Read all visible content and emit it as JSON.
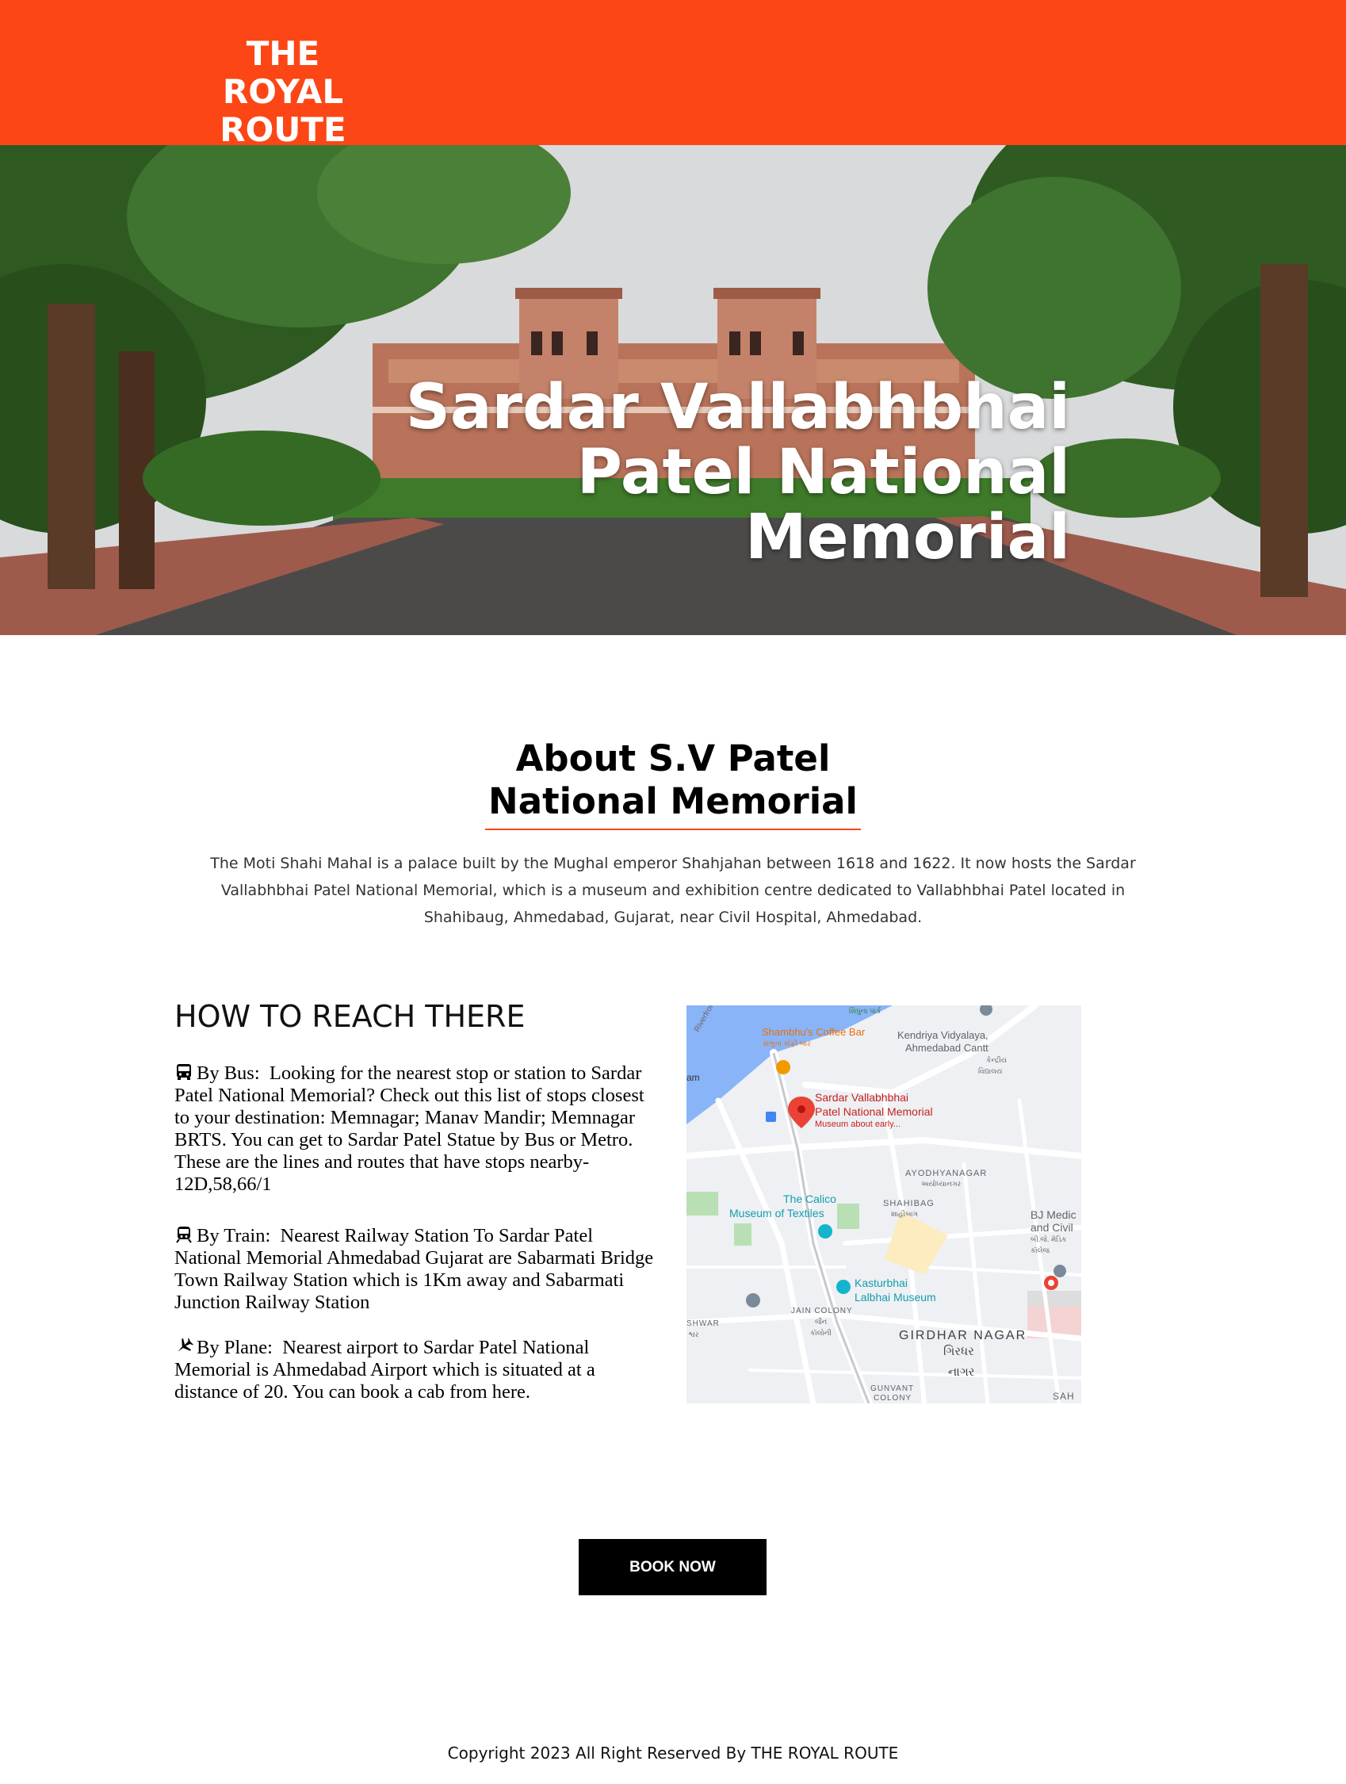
{
  "header": {
    "logo_line1": "THE ROYAL",
    "logo_line2": "ROUTE",
    "background": "#fc4616"
  },
  "hero": {
    "title_line1": "Sardar Vallabhbhai",
    "title_line2": "Patel National Memorial"
  },
  "about": {
    "title_line1": "About S.V Patel",
    "title_line2": "National Memorial",
    "text": "The Moti Shahi Mahal is a palace built by the Mughal emperor Shahjahan between 1618 and 1622. It now hosts the Sardar Vallabhbhai Patel National Memorial, which is a museum and exhibition centre dedicated to Vallabhbhai Patel located in Shahibaug, Ahmedabad, Gujarat, near Civil Hospital, Ahmedabad."
  },
  "reach": {
    "title": "HOW TO REACH THERE",
    "items": [
      {
        "icon": "bus-icon",
        "label": "By Bus:",
        "text": "Looking for the nearest stop or station to Sardar Patel National Memorial? Check out this list of stops closest to your destination: Memnagar; Manav Mandir; Memnagar BRTS. You can get to Sardar Patel Statue by Bus or Metro. These are the lines and routes that have stops nearby- 12D,58,66/1"
      },
      {
        "icon": "train-icon",
        "label": "By Train:",
        "text": "Nearest Railway Station To Sardar Patel National Memorial Ahmedabad Gujarat are Sabarmati Bridge Town Railway Station which is 1Km away and Sabarmati Junction Railway Station"
      },
      {
        "icon": "plane-icon",
        "label": "By Plane:",
        "text": "Nearest airport to Sardar Patel National Memorial is Ahmedabad Airport which is situated at a distance of 20. You can book a cab from here."
      }
    ]
  },
  "map": {
    "pin_title_line1": "Sardar Vallabhbhai",
    "pin_title_line2": "Patel National Memorial",
    "pin_subtitle": "Museum about early...",
    "labels": {
      "coffee": "Shambhu's Coffee Bar",
      "coffee_local": "શંભુના કોફી બાર",
      "kendriya_1": "Kendriya Vidyalaya,",
      "kendriya_2": "Ahmedabad Cantt",
      "kendriya_local_1": "કેન્દ્રીય",
      "kendriya_local_2": "વિદ્યાલય",
      "ayodhyanagar": "AYODHYANAGAR",
      "ayodhyanagar_local": "અયોધ્યાનગર",
      "shahibag": "SHAHIBAG",
      "shahibag_local": "શાહીબાગ",
      "calico_1": "The Calico",
      "calico_2": "Museum of Textiles",
      "bj_1": "BJ Medic",
      "bj_2": "and Civil",
      "bj_local_1": "બી.જે. મેડિક",
      "bj_local_2": "કૉલેજ",
      "kasturbhai_1": "Kasturbhai",
      "kasturbhai_2": "Lalbhai Museum",
      "jain_colony": "JAIN COLONY",
      "jain_local_1": "જૈન",
      "jain_local_2": "કૉલોની",
      "girdhar": "GIRDHAR NAGAR",
      "girdhar_local_1": "ગિરધર",
      "girdhar_local_2": "નાગર",
      "gunvant_1": "GUNVANT",
      "gunvant_2": "COLONY",
      "shwar": "SHWAR",
      "shwar_local": "શ્વર",
      "riverfront": "Riverfront Rd",
      "am": "am",
      "sah": "SAH",
      "top_local": "સિંધુના પાર્ક"
    }
  },
  "cta": {
    "label": "BOOK NOW"
  },
  "footer": {
    "text": "Copyright 2023 All Right Reserved By THE ROYAL ROUTE"
  }
}
